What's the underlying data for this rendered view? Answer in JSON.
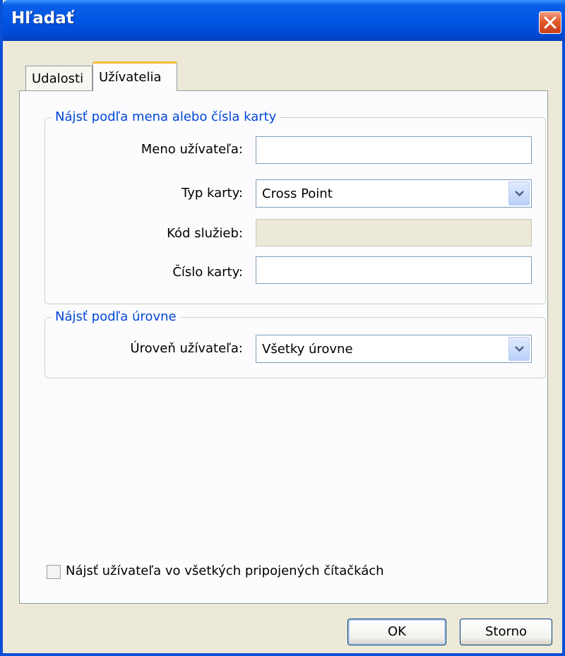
{
  "window": {
    "title": "Hľadať",
    "close_icon": "close-icon"
  },
  "tabs": [
    {
      "label": "Udalosti",
      "active": false
    },
    {
      "label": "Užívatelia",
      "active": true
    }
  ],
  "group_name_card": {
    "legend": "Nájsť podľa mena alebo čísla karty",
    "fields": {
      "username": {
        "label": "Meno užívateľa:",
        "value": ""
      },
      "card_type": {
        "label": "Typ karty:",
        "value": "Cross Point"
      },
      "service_code": {
        "label": "Kód služieb:",
        "value": "",
        "disabled": true
      },
      "card_number": {
        "label": "Číslo karty:",
        "value": ""
      }
    }
  },
  "group_level": {
    "legend": "Nájsť podľa úrovne",
    "fields": {
      "user_level": {
        "label": "Úroveň užívateľa:",
        "value": "Všetky úrovne"
      }
    }
  },
  "options": {
    "search_all_readers": {
      "label": "Nájsť užívateľa vo všetkých pripojených čítačkách",
      "checked": false
    }
  },
  "buttons": {
    "ok": "OK",
    "cancel": "Storno"
  },
  "colors": {
    "titlebar": "#0055e5",
    "legend_text": "#0046d5",
    "dialog_bg": "#ece9d8",
    "close_button": "#e25b2d",
    "active_tab_accent": "#ffb935"
  }
}
